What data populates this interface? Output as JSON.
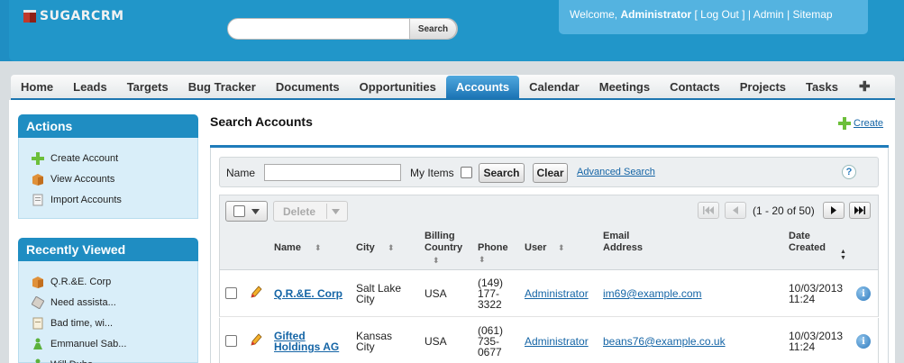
{
  "header": {
    "logo_text": "SUGARCRM",
    "search": {
      "placeholder": "",
      "button_label": "Search"
    },
    "welcome": {
      "prefix": "Welcome,",
      "user": "Administrator",
      "logout": "[ Log Out ]",
      "sep1": "|",
      "admin": "Admin",
      "sep2": "|",
      "sitemap": "Sitemap"
    }
  },
  "nav": {
    "tabs": [
      "Home",
      "Leads",
      "Targets",
      "Bug Tracker",
      "Documents",
      "Opportunities",
      "Accounts",
      "Calendar",
      "Meetings",
      "Contacts",
      "Projects",
      "Tasks"
    ],
    "active": "Accounts",
    "more": "✚"
  },
  "sidebar": {
    "actions_title": "Actions",
    "actions": [
      {
        "label": "Create Account",
        "icon": "plus-icon"
      },
      {
        "label": "View Accounts",
        "icon": "accounts-icon"
      },
      {
        "label": "Import Accounts",
        "icon": "import-icon"
      }
    ],
    "recent_title": "Recently Viewed",
    "recent": [
      {
        "label": "Q.R.&E. Corp",
        "icon": "accounts-icon"
      },
      {
        "label": "Need assista...",
        "icon": "case-icon"
      },
      {
        "label": "Bad time, wi...",
        "icon": "note-icon"
      },
      {
        "label": "Emmanuel Sab...",
        "icon": "contact-icon"
      },
      {
        "label": "Will Dube...",
        "icon": "contact-icon"
      }
    ]
  },
  "main": {
    "title": "Search Accounts",
    "create_label": "Create",
    "search": {
      "name_label": "Name",
      "name_value": "",
      "my_items_label": "My Items",
      "search_button": "Search",
      "clear_button": "Clear",
      "advanced_link": "Advanced Search",
      "help": "?"
    },
    "list": {
      "delete_label": "Delete",
      "pagination": "(1 - 20 of 50)",
      "columns": [
        {
          "label": "Name",
          "sortable": true
        },
        {
          "label": "City",
          "sortable": true
        },
        {
          "label": "Billing Country",
          "sortable": true
        },
        {
          "label": "Phone",
          "sortable": true
        },
        {
          "label": "User",
          "sortable": true
        },
        {
          "label": "Email Address",
          "sortable": false
        },
        {
          "label": "Date Created",
          "sortable": true
        }
      ],
      "rows": [
        {
          "name_lines": [
            "Q.R.&E. Corp"
          ],
          "city_lines": [
            "Salt Lake",
            "City"
          ],
          "country": "USA",
          "phone_lines": [
            "(149)",
            "177-",
            "3322"
          ],
          "user": "Administrator",
          "email": "im69@example.com",
          "date_lines": [
            "10/03/2013",
            "11:24"
          ]
        },
        {
          "name_lines": [
            "Gifted",
            "Holdings AG"
          ],
          "city_lines": [
            "Kansas",
            "City"
          ],
          "country": "USA",
          "phone_lines": [
            "(061)",
            "735-",
            "0677"
          ],
          "user": "Administrator",
          "email": "beans76@example.co.uk",
          "date_lines": [
            "10/03/2013",
            "11:24"
          ]
        }
      ]
    }
  },
  "colors": {
    "header": "#2196c9",
    "accent": "#1f7cba",
    "link": "#1565a6",
    "panel": "#d9eef9"
  }
}
